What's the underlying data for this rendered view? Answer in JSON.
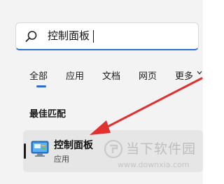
{
  "search": {
    "query": "控制面板"
  },
  "tabs": [
    {
      "label": "全部"
    },
    {
      "label": "应用"
    },
    {
      "label": "文档"
    },
    {
      "label": "网页"
    },
    {
      "label": "更多"
    }
  ],
  "best_match": {
    "title": "最佳匹配",
    "item": {
      "name": "控制面板",
      "type": "应用",
      "icon": "control-panel-icon"
    }
  },
  "watermark": {
    "site": "当下软件园",
    "url": "www.downxia.com"
  },
  "colors": {
    "accent": "#2f6ec8",
    "arrow": "#e03030"
  }
}
